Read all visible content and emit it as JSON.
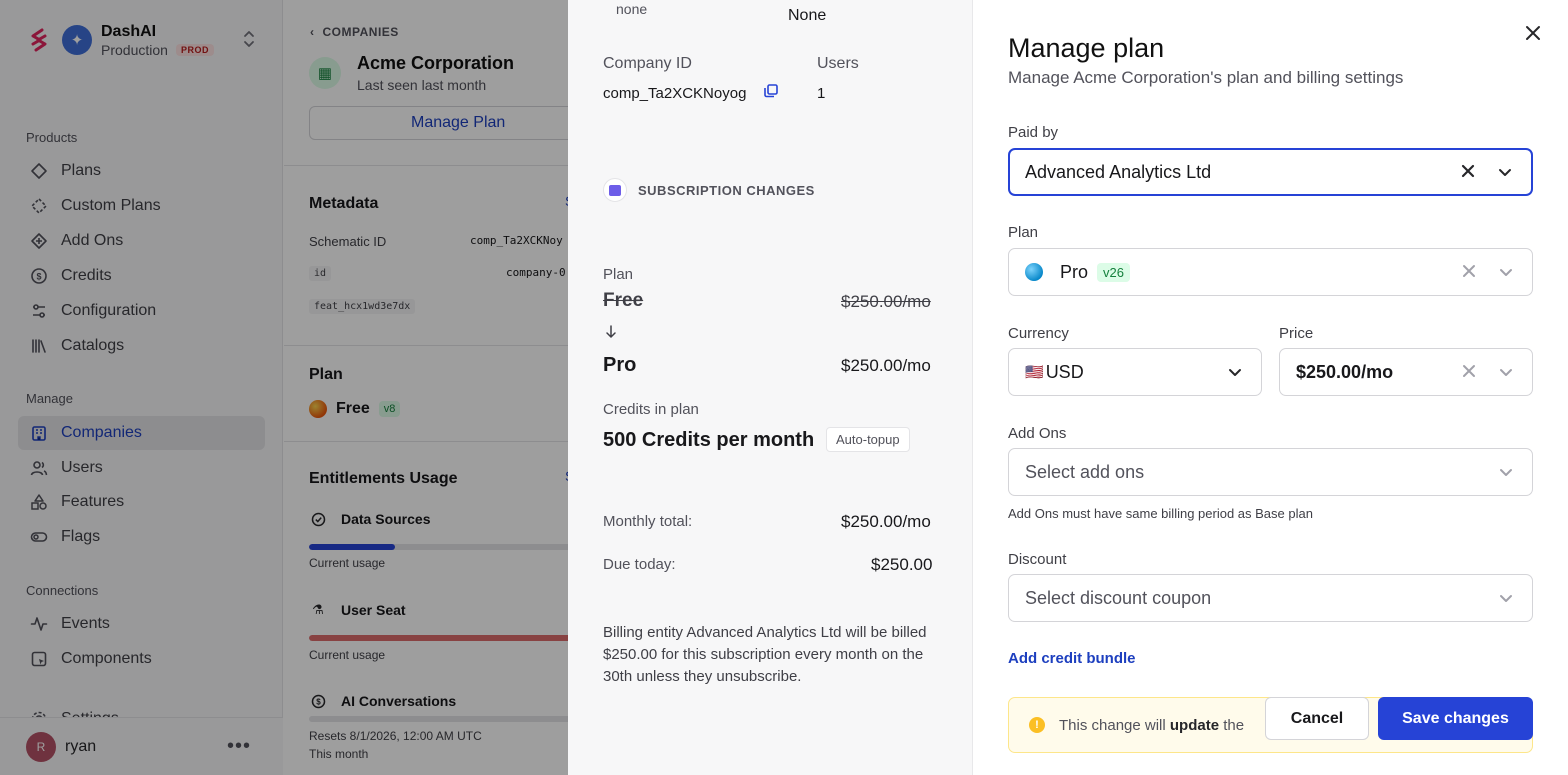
{
  "sidebar": {
    "app_name": "DashAI",
    "environment": "Production",
    "environment_badge": "PROD",
    "sections": {
      "products": "Products",
      "manage": "Manage",
      "connections": "Connections"
    },
    "products_items": [
      {
        "label": "Plans",
        "icon": "diamond-icon"
      },
      {
        "label": "Custom Plans",
        "icon": "dashed-diamond-icon"
      },
      {
        "label": "Add Ons",
        "icon": "diamond-plus-icon"
      },
      {
        "label": "Credits",
        "icon": "dollar-circle-icon"
      },
      {
        "label": "Configuration",
        "icon": "sliders-icon"
      },
      {
        "label": "Catalogs",
        "icon": "library-icon"
      }
    ],
    "manage_items": [
      {
        "label": "Companies",
        "icon": "building-icon",
        "active": true
      },
      {
        "label": "Users",
        "icon": "users-icon"
      },
      {
        "label": "Features",
        "icon": "shapes-icon"
      },
      {
        "label": "Flags",
        "icon": "toggle-icon"
      }
    ],
    "connections_items": [
      {
        "label": "Events",
        "icon": "activity-icon"
      },
      {
        "label": "Components",
        "icon": "component-icon"
      },
      {
        "label": "Settings",
        "icon": "gear-icon"
      }
    ],
    "user": {
      "initial": "R",
      "name": "ryan"
    }
  },
  "company": {
    "breadcrumb": "COMPANIES",
    "name": "Acme Corporation",
    "last_seen": "Last seen last month",
    "manage_plan_label": "Manage Plan",
    "metadata_title": "Metadata",
    "schematic_id_label": "Schematic ID",
    "schematic_id_value": "comp_Ta2XCKNoy",
    "id_key": "id",
    "id_value": "company-0",
    "feature_key": "feat_hcx1wd3e7dx",
    "plan_title": "Plan",
    "plan_name": "Free",
    "plan_version": "v8",
    "entitlements_title": "Entitlements Usage",
    "entitlements": [
      {
        "name": "Data Sources",
        "caption": "Current usage",
        "fraction": 0.33,
        "color": "#2643d6"
      },
      {
        "name": "User Seat",
        "caption": "Current usage",
        "fraction": 1.0,
        "color": "#dc6b6b"
      },
      {
        "name": "AI Conversations",
        "caption": "Resets 8/1/2026, 12:00 AM UTC",
        "caption2": "This month",
        "fraction": 0.0,
        "color": "#2643d6"
      }
    ],
    "see_link": "S"
  },
  "preview": {
    "prev_key": "none",
    "prev_value": "None",
    "company_id_label": "Company ID",
    "company_id_value": "comp_Ta2XCKNoyog",
    "users_label": "Users",
    "users_value": "1",
    "subscription_changes": "SUBSCRIPTION CHANGES",
    "plan_label": "Plan",
    "old_plan": "Free",
    "old_price": "$250.00/mo",
    "new_plan": "Pro",
    "new_price": "$250.00/mo",
    "credits_label": "Credits in plan",
    "credits_value": "500 Credits per month",
    "auto_topup": "Auto-topup",
    "monthly_total_label": "Monthly total:",
    "monthly_total_value": "$250.00/mo",
    "due_today_label": "Due today:",
    "due_today_value": "$250.00",
    "billing_note": "Billing entity Advanced Analytics Ltd will be billed $250.00 for this subscription every month on the 30th unless they unsubscribe."
  },
  "drawer": {
    "title": "Manage plan",
    "subtitle": "Manage Acme Corporation's plan and billing settings",
    "paid_by_label": "Paid by",
    "paid_by_value": "Advanced Analytics Ltd",
    "plan_label": "Plan",
    "plan_value": "Pro",
    "plan_version": "v26",
    "currency_label": "Currency",
    "currency_flag": "🇺🇸",
    "currency_value": "USD",
    "price_label": "Price",
    "price_value": "$250.00/mo",
    "addons_label": "Add Ons",
    "addons_placeholder": "Select add ons",
    "addons_help": "Add Ons must have same billing period as Base plan",
    "discount_label": "Discount",
    "discount_placeholder": "Select discount coupon",
    "add_credit_bundle": "Add credit bundle",
    "warning_prefix": "This change will",
    "warning_bold": "update",
    "warning_suffix": "the",
    "cancel_label": "Cancel",
    "save_label": "Save changes"
  }
}
